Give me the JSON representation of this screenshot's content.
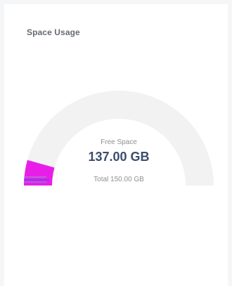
{
  "widget": {
    "title": "Space Usage",
    "free_label": "Free Space",
    "free_value": "137.00 GB",
    "total_label": "Total 150.00 GB"
  },
  "gauge": {
    "used_gb": 13,
    "total_gb": 150,
    "used_color": "#e81ee8",
    "track_color": "#f2f2f2"
  }
}
